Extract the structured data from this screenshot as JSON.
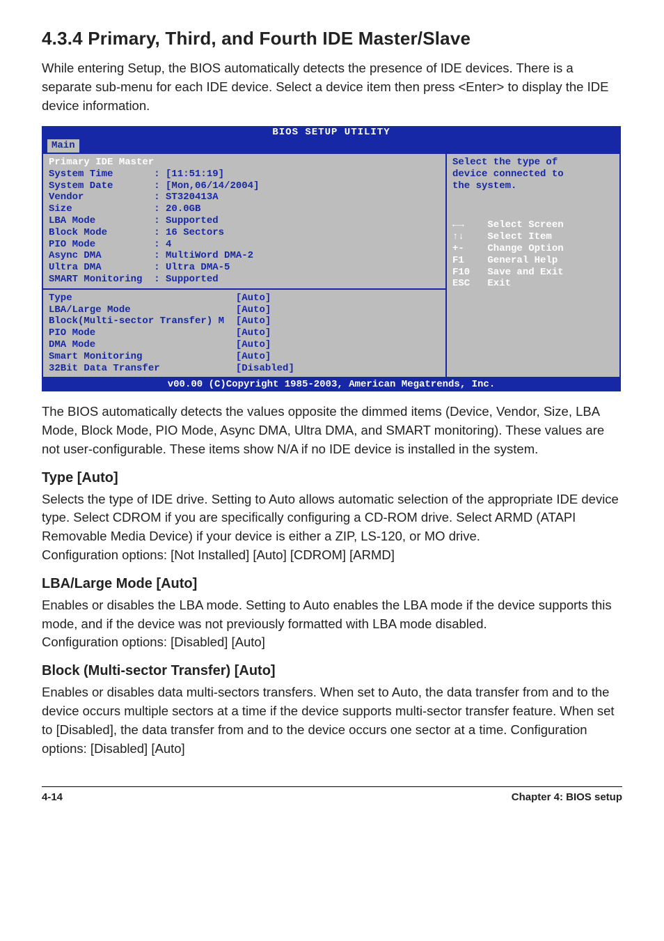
{
  "heading": "4.3.4   Primary, Third, and Fourth IDE Master/Slave",
  "intro": "While entering Setup, the BIOS automatically detects the presence of IDE devices. There is a separate sub-menu for each IDE device. Select a device item then press <Enter> to display the IDE device information.",
  "bios": {
    "title": "BIOS SETUP UTILITY",
    "tab": "Main",
    "panel_title": "Primary IDE Master",
    "info_rows": [
      {
        "label": "System Time",
        "value": ": [11:51:19]"
      },
      {
        "label": "System Date",
        "value": ": [Mon,06/14/2004]"
      },
      {
        "label": "Vendor",
        "value": ": ST320413A"
      },
      {
        "label": "Size",
        "value": ": 20.0GB"
      },
      {
        "label": "LBA Mode",
        "value": ": Supported"
      },
      {
        "label": "Block Mode",
        "value": ": 16 Sectors"
      },
      {
        "label": "PIO Mode",
        "value": ": 4"
      },
      {
        "label": "Async DMA",
        "value": ": MultiWord DMA-2"
      },
      {
        "label": "Ultra DMA",
        "value": ": Ultra DMA-5"
      },
      {
        "label": "SMART Monitoring",
        "value": ": Supported"
      }
    ],
    "option_rows": [
      {
        "label": "Type",
        "value": "[Auto]"
      },
      {
        "label": "LBA/Large Mode",
        "value": "[Auto]"
      },
      {
        "label": "Block(Multi-sector Transfer) M",
        "value": "[Auto]"
      },
      {
        "label": "PIO Mode",
        "value": "[Auto]"
      },
      {
        "label": "DMA Mode",
        "value": "[Auto]"
      },
      {
        "label": "Smart Monitoring",
        "value": "[Auto]"
      },
      {
        "label": "32Bit Data Transfer",
        "value": "[Disabled]"
      }
    ],
    "help_text_l1": "Select the type of",
    "help_text_l2": "device connected to",
    "help_text_l3": "the system.",
    "legend": [
      {
        "key": "←→",
        "desc": "Select Screen"
      },
      {
        "key": "↑↓",
        "desc": "Select Item"
      },
      {
        "key": "+-",
        "desc": "Change Option"
      },
      {
        "key": "F1",
        "desc": "General Help"
      },
      {
        "key": "F10",
        "desc": "Save and Exit"
      },
      {
        "key": "ESC",
        "desc": "Exit"
      }
    ],
    "footer": "v00.00 (C)Copyright 1985-2003, American Megatrends, Inc."
  },
  "after_bios": "The BIOS automatically detects the values opposite the dimmed items (Device, Vendor, Size, LBA Mode, Block Mode, PIO Mode, Async DMA, Ultra DMA, and SMART monitoring). These values are not user-configurable. These items show N/A if no IDE device is installed in the system.",
  "type_heading": "Type [Auto]",
  "type_text": "Selects the type of IDE drive. Setting to Auto allows automatic selection of the appropriate IDE device type. Select CDROM if you are specifically configuring a CD-ROM drive. Select ARMD (ATAPI Removable Media Device) if your device is either a ZIP, LS-120, or MO drive.\nConfiguration options: [Not Installed] [Auto] [CDROM] [ARMD]",
  "lba_heading": "LBA/Large Mode [Auto]",
  "lba_text": "Enables or disables the LBA mode. Setting to Auto enables the LBA mode if the device supports this mode, and if the device was not previously formatted with LBA mode disabled.\nConfiguration options: [Disabled] [Auto]",
  "block_heading": "Block (Multi-sector Transfer) [Auto]",
  "block_text": "Enables or disables data multi-sectors transfers. When set to Auto, the data transfer from and to the device occurs multiple sectors at a time if the device supports multi-sector transfer feature. When set to [Disabled], the data transfer from and to the device occurs one sector at a time. Configuration options: [Disabled] [Auto]",
  "footer_left": "4-14",
  "footer_right": "Chapter 4: BIOS setup"
}
